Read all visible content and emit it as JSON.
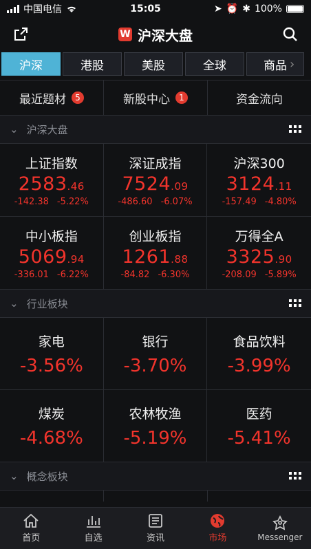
{
  "status_bar": {
    "carrier": "中国电信",
    "time": "15:05",
    "battery": "100%"
  },
  "header": {
    "title": "沪深大盘",
    "logo_letter": "W"
  },
  "tabs": [
    {
      "label": "沪深",
      "active": true
    },
    {
      "label": "港股"
    },
    {
      "label": "美股"
    },
    {
      "label": "全球"
    },
    {
      "label": "商品"
    }
  ],
  "subnav": [
    {
      "label": "最近题材",
      "badge": "5"
    },
    {
      "label": "新股中心",
      "badge": "1"
    },
    {
      "label": "资金流向"
    }
  ],
  "sections": {
    "market": "沪深大盘",
    "industry": "行业板块",
    "concept": "概念板块"
  },
  "indices": [
    {
      "name": "上证指数",
      "int": "2583",
      "dec": ".46",
      "chg": "-142.38",
      "pct": "-5.22%"
    },
    {
      "name": "深证成指",
      "int": "7524",
      "dec": ".09",
      "chg": "-486.60",
      "pct": "-6.07%"
    },
    {
      "name": "沪深300",
      "int": "3124",
      "dec": ".11",
      "chg": "-157.49",
      "pct": "-4.80%"
    },
    {
      "name": "中小板指",
      "int": "5069",
      "dec": ".94",
      "chg": "-336.01",
      "pct": "-6.22%"
    },
    {
      "name": "创业板指",
      "int": "1261",
      "dec": ".88",
      "chg": "-84.82",
      "pct": "-6.30%"
    },
    {
      "name": "万得全A",
      "int": "3325",
      "dec": ".90",
      "chg": "-208.09",
      "pct": "-5.89%"
    }
  ],
  "industries": [
    {
      "name": "家电",
      "pct": "-3.56%"
    },
    {
      "name": "银行",
      "pct": "-3.70%"
    },
    {
      "name": "食品饮料",
      "pct": "-3.99%"
    },
    {
      "name": "煤炭",
      "pct": "-4.68%"
    },
    {
      "name": "农林牧渔",
      "pct": "-5.19%"
    },
    {
      "name": "医药",
      "pct": "-5.41%"
    }
  ],
  "bottom_nav": [
    {
      "label": "首页",
      "icon": "home-icon"
    },
    {
      "label": "自选",
      "icon": "chart-icon"
    },
    {
      "label": "资讯",
      "icon": "news-icon"
    },
    {
      "label": "市场",
      "icon": "globe-icon",
      "active": true
    },
    {
      "label": "Messenger",
      "icon": "messenger-icon"
    }
  ],
  "colors": {
    "accent": "#4fb3d6",
    "down": "#f2342c",
    "brand": "#e23b2f",
    "background": "#111214"
  }
}
